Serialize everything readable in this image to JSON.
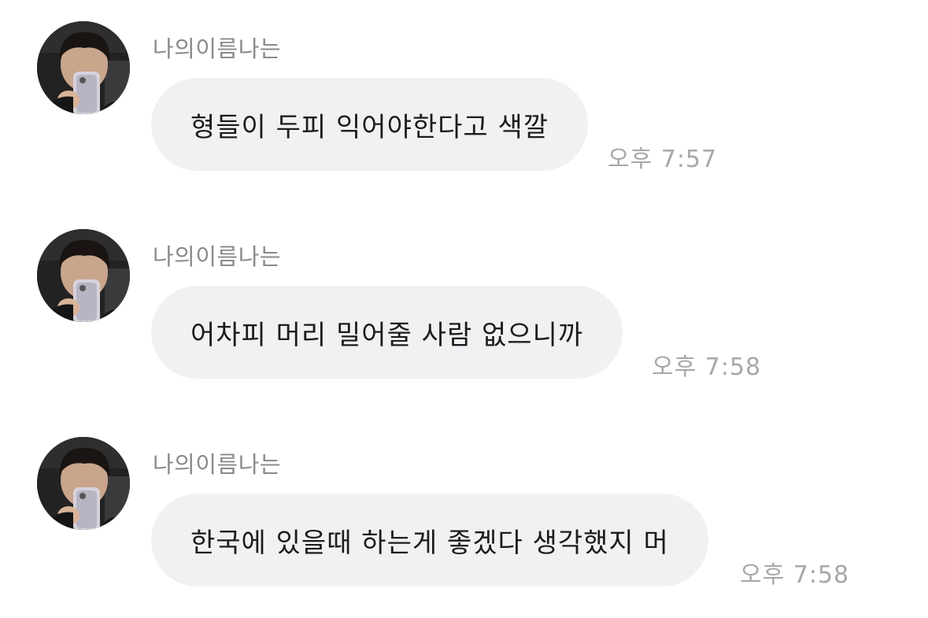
{
  "messages": [
    {
      "sender": "나의이름나는",
      "text": "형들이 두피 익어야한다고 색깔",
      "time": "오후 7:57",
      "avatar": "profile-photo-icon"
    },
    {
      "sender": "나의이름나는",
      "text": "어차피 머리 밀어줄 사람 없으니까",
      "time": "오후 7:58",
      "avatar": "profile-photo-icon"
    },
    {
      "sender": "나의이름나는",
      "text": "한국에 있을때 하는게 좋겠다 생각했지 머",
      "time": "오후 7:58",
      "avatar": "profile-photo-icon"
    }
  ],
  "colors": {
    "bubble": "#f1f1f4",
    "text": "#1c1c1e",
    "sender": "#8a8a8e",
    "time": "#a7a7ab"
  }
}
